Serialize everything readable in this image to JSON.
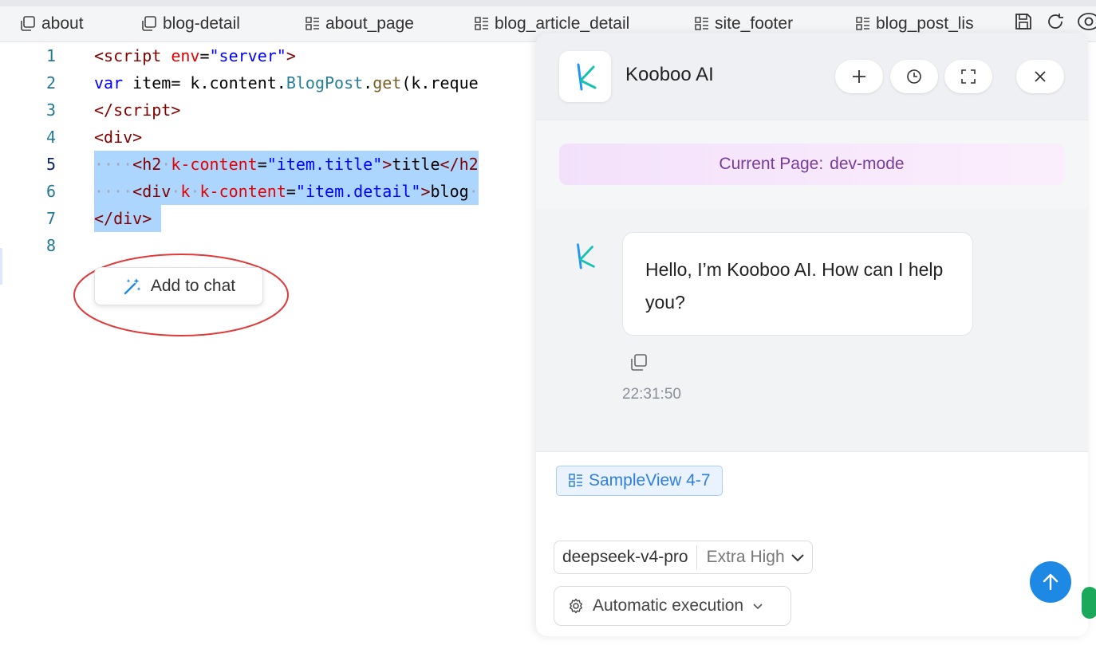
{
  "tabs": [
    {
      "label": "about",
      "icon": "copy-icon"
    },
    {
      "label": "blog-detail",
      "icon": "copy-icon"
    },
    {
      "label": "about_page",
      "icon": "layout-list-icon"
    },
    {
      "label": "blog_article_detail",
      "icon": "layout-list-icon"
    },
    {
      "label": "site_footer",
      "icon": "layout-list-icon"
    },
    {
      "label": "blog_post_lis",
      "icon": "layout-list-icon"
    }
  ],
  "toolbar_icons": [
    "save-icon",
    "refresh-icon",
    "preview-eye-icon"
  ],
  "editor": {
    "line_numbers": [
      "1",
      "2",
      "3",
      "4",
      "5",
      "6",
      "7",
      "8"
    ],
    "active_line": "5",
    "add_to_chat_label": "Add to chat"
  },
  "panel": {
    "title": "Kooboo AI",
    "header_buttons": [
      "new-chat-icon",
      "history-icon",
      "fullscreen-icon",
      "close-icon"
    ],
    "current_page_label": "Current Page:",
    "current_page_value": "dev-mode",
    "message": "Hello, I’m Kooboo AI. How can I help you?",
    "message_time": "22:31:50",
    "context_chip": "SampleView 4-7",
    "model_name": "deepseek-v4-pro",
    "model_level": "Extra High",
    "execution_mode": "Automatic execution"
  },
  "colors": {
    "accent": "#1e88e5",
    "selection": "#add6ff",
    "current_page_text": "#7a3c9c",
    "annotation_circle": "#e03a3a"
  }
}
